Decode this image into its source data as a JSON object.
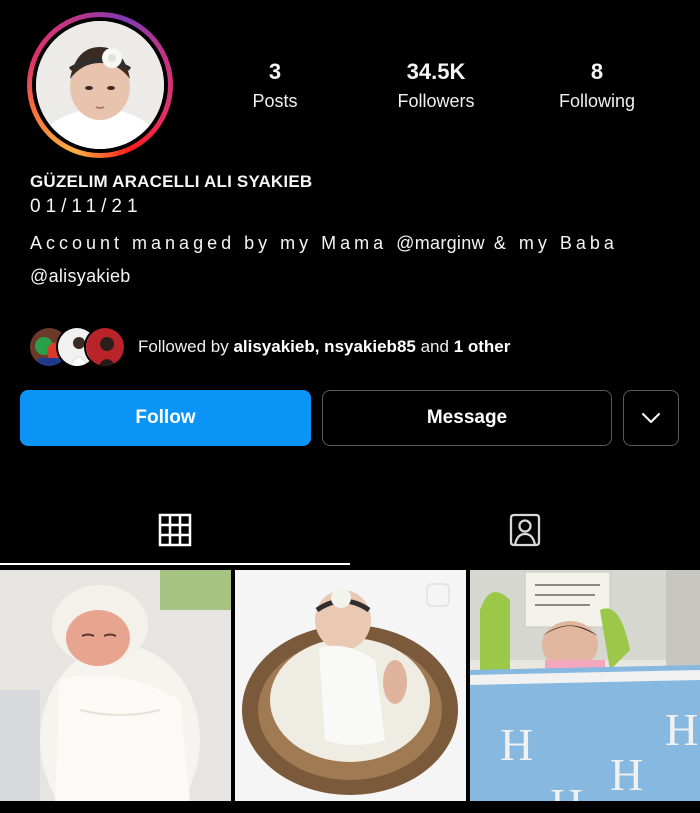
{
  "profile": {
    "posts_count": "3",
    "posts_label": "Posts",
    "followers_count": "34.5K",
    "followers_label": "Followers",
    "following_count": "8",
    "following_label": "Following",
    "name": "GÜZELIM ARACELLI ALI SYAKIEB",
    "bio_line1": "01/11/21",
    "bio_text_a": "Account managed by my Mama",
    "bio_handle_1": "@marginw",
    "bio_text_b": "& my Baba",
    "bio_handle_2": "@alisyakieb"
  },
  "followed_by": {
    "prefix": "Followed by",
    "names": "alisyakieb, nsyakieb85",
    "and": "and",
    "other": "1 other"
  },
  "actions": {
    "follow_label": "Follow",
    "message_label": "Message",
    "more_icon": "chevron-down-icon"
  },
  "tabs": [
    {
      "icon": "grid-icon",
      "active": true
    },
    {
      "icon": "tagged-icon",
      "active": false
    }
  ],
  "colors": {
    "follow_button": "#0a95f6",
    "background": "#000000",
    "active_tab_indicator": "#ffffff"
  }
}
